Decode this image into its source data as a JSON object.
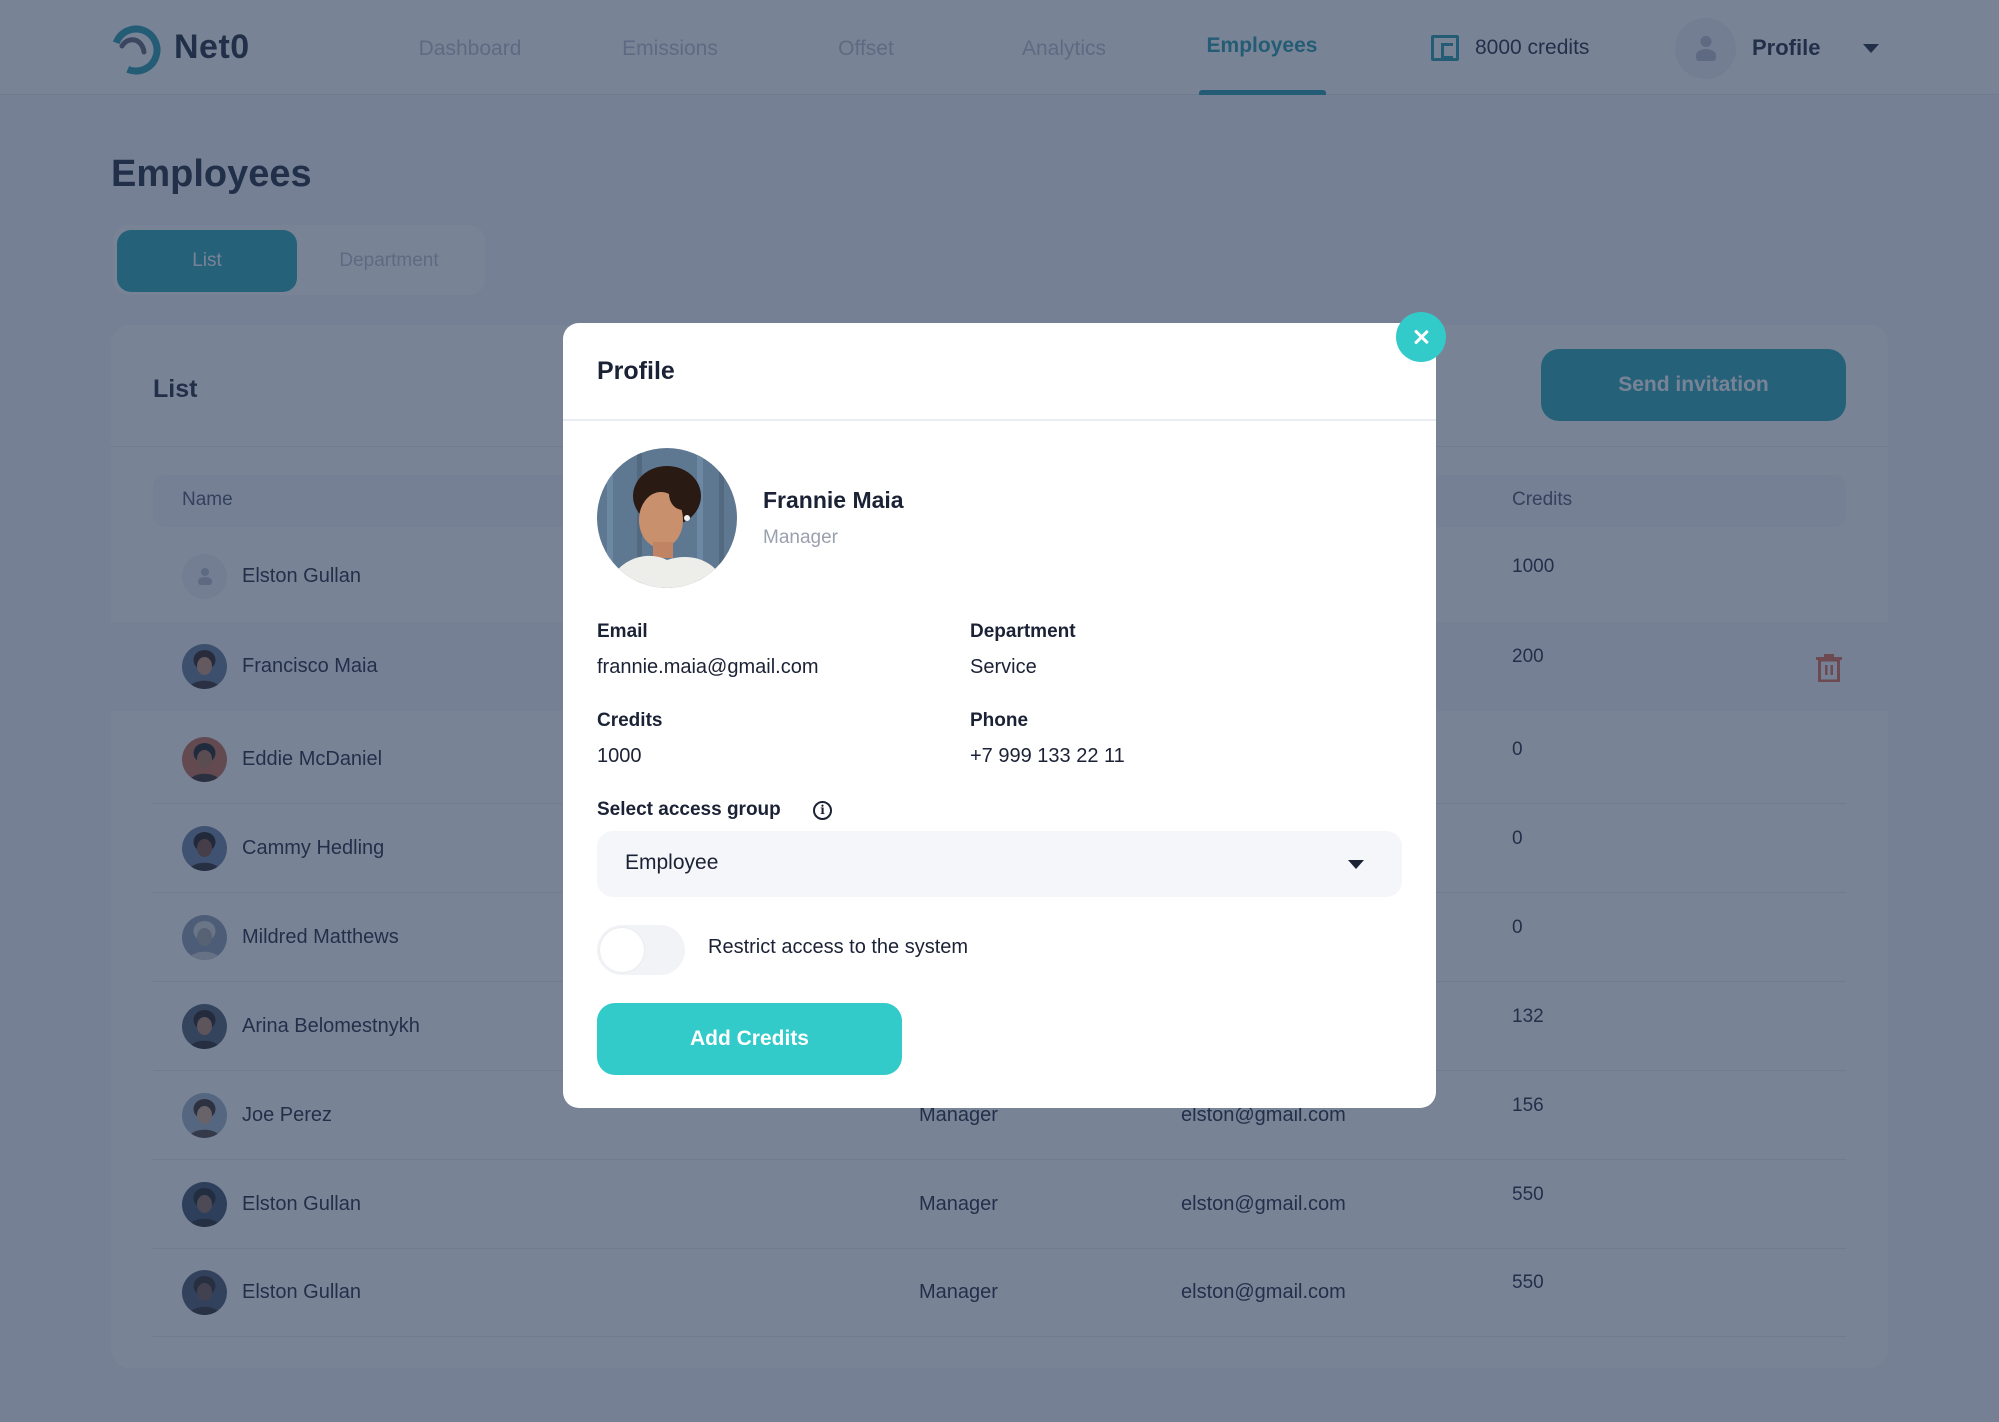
{
  "app": {
    "name": "Net0",
    "brand_color": "#1E9AA6",
    "accent_color": "#33CACA"
  },
  "nav": {
    "items": [
      {
        "label": "Dashboard",
        "active": false
      },
      {
        "label": "Emissions",
        "active": false
      },
      {
        "label": "Offset",
        "active": false
      },
      {
        "label": "Analytics",
        "active": false
      },
      {
        "label": "Employees",
        "active": true
      }
    ],
    "credits": "8000 credits",
    "profile_label": "Profile"
  },
  "page": {
    "title": "Employees",
    "tabs": [
      {
        "label": "List",
        "active": true
      },
      {
        "label": "Department",
        "active": false
      }
    ]
  },
  "list": {
    "title": "List",
    "send_invitation_label": "Send invitation",
    "columns": {
      "name": "Name",
      "credits": "Credits"
    },
    "rows": [
      {
        "name": "Elston Gullan",
        "role": "",
        "email": "",
        "credits": "1000",
        "avatar": "placeholder",
        "highlight": false,
        "trash": false
      },
      {
        "name": "Francisco Maia",
        "role": "",
        "email": "",
        "credits": "200",
        "avatar": "photo",
        "highlight": true,
        "trash": true
      },
      {
        "name": "Eddie McDaniel",
        "role": "",
        "email": "",
        "credits": "0",
        "avatar": "photo",
        "highlight": false,
        "trash": false
      },
      {
        "name": "Cammy Hedling",
        "role": "",
        "email": "",
        "credits": "0",
        "avatar": "photo",
        "highlight": false,
        "trash": false
      },
      {
        "name": "Mildred Matthews",
        "role": "",
        "email": "",
        "credits": "0",
        "avatar": "photo",
        "highlight": false,
        "trash": false
      },
      {
        "name": "Arina Belomestnykh",
        "role": "",
        "email": "",
        "credits": "132",
        "avatar": "photo",
        "highlight": false,
        "trash": false
      },
      {
        "name": "Joe Perez",
        "role": "Manager",
        "email": "elston@gmail.com",
        "credits": "156",
        "avatar": "photo",
        "highlight": false,
        "trash": false
      },
      {
        "name": "Elston Gullan",
        "role": "Manager",
        "email": "elston@gmail.com",
        "credits": "550",
        "avatar": "photo",
        "highlight": false,
        "trash": false
      },
      {
        "name": "Elston Gullan",
        "role": "Manager",
        "email": "elston@gmail.com",
        "credits": "550",
        "avatar": "photo",
        "highlight": false,
        "trash": false
      }
    ]
  },
  "modal": {
    "title": "Profile",
    "name": "Frannie Maia",
    "role": "Manager",
    "fields": {
      "email_label": "Email",
      "email_value": "frannie.maia@gmail.com",
      "department_label": "Department",
      "department_value": "Service",
      "credits_label": "Credits",
      "credits_value": "1000",
      "phone_label": "Phone",
      "phone_value": "+7 999 133 22 11"
    },
    "access_group_label": "Select access group",
    "access_group_value": "Employee",
    "restrict_label": "Restrict access to the system",
    "restrict_enabled": false,
    "add_credits_label": "Add Credits"
  }
}
